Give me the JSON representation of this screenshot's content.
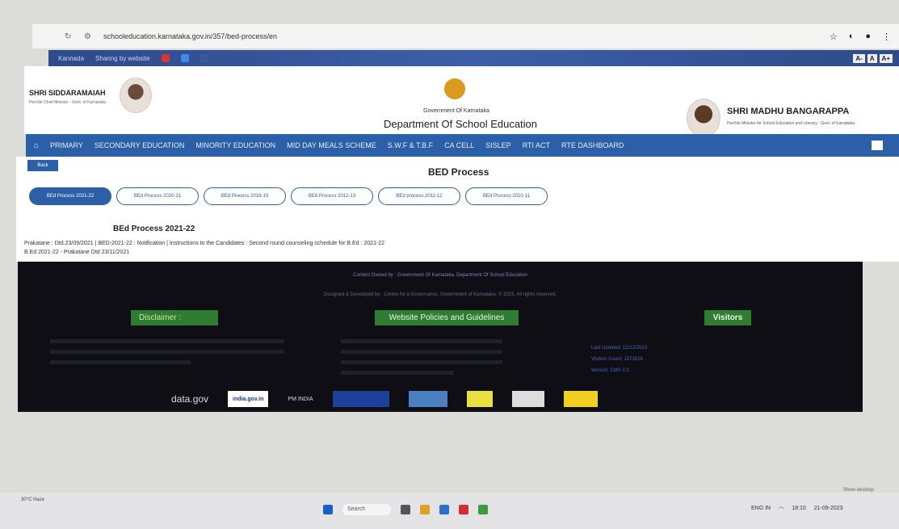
{
  "browser": {
    "url": "schooleducation.karnataka.gov.in/357/bed-process/en"
  },
  "topstrip": {
    "items": [
      "Kannada",
      "Sharing by website"
    ],
    "font_buttons": [
      "A-",
      "A",
      "A+"
    ]
  },
  "header": {
    "cm_name": "SHRI SIDDARAMAIAH",
    "cm_title": "Hon'ble Chief Minister - Govt. of Karnataka",
    "government": "Government Of Karnataka",
    "department": "Department Of School Education",
    "minister_name": "SHRI MADHU BANGARAPPA",
    "minister_title": "Hon'ble Minister for School Education and Literacy - Govt. of Karnataka"
  },
  "nav": {
    "items": [
      "PRIMARY",
      "SECONDARY EDUCATION",
      "MINORITY EDUCATION",
      "MID DAY MEALS SCHEME",
      "S.W.F & T.B.F",
      "CA CELL",
      "SISLEP",
      "RTI ACT",
      "RTE DASHBOARD"
    ]
  },
  "content": {
    "back_label": "Back",
    "page_title": "BED Process",
    "tabs": [
      "BEd Process 2021-22",
      "BEd Process 2020-21",
      "BEd Process 2018-19",
      "BEd Process 2012-13",
      "BEd process 2011-12",
      "BEd Process 2010-11"
    ],
    "section_title": "BEd Process 2021-22",
    "line1": "Prakatane : Dtd.23/09/2021 | BED-2021-22 : Notification | Instructions to the Candidates : Second round counseling schedule for B.Ed : 2021-22",
    "line2": "B.Ed 2021-22 - Prakatane Dtd 23/11/2021"
  },
  "footer": {
    "line1": "Content Owned by : Government Of Karnataka, Department Of School Education",
    "line2": "Designed & Developed by : Centre for e-Governance, Government of Karnataka. © 2023, All rights reserved.",
    "disclaimer": "Disclaimer :",
    "policies": "Website Policies and Guidelines",
    "visitors": "Visitors",
    "visitor_lines": [
      "Last Updated: 12/12/2023",
      "Visitors Count: 1571526",
      "Version: CMS 2.0"
    ],
    "logos": [
      "data.gov",
      "india.gov.in",
      "PM INDIA"
    ]
  },
  "taskbar": {
    "weather": "30°C Haze",
    "search": "Search",
    "time": "18:10",
    "date": "21-09-2023",
    "lang": "ENG IN",
    "show_desktop": "Show desktop"
  },
  "colors": {
    "nav": "#2b5fa8",
    "footer": "#0e0e14",
    "green": "#2e7d32"
  }
}
